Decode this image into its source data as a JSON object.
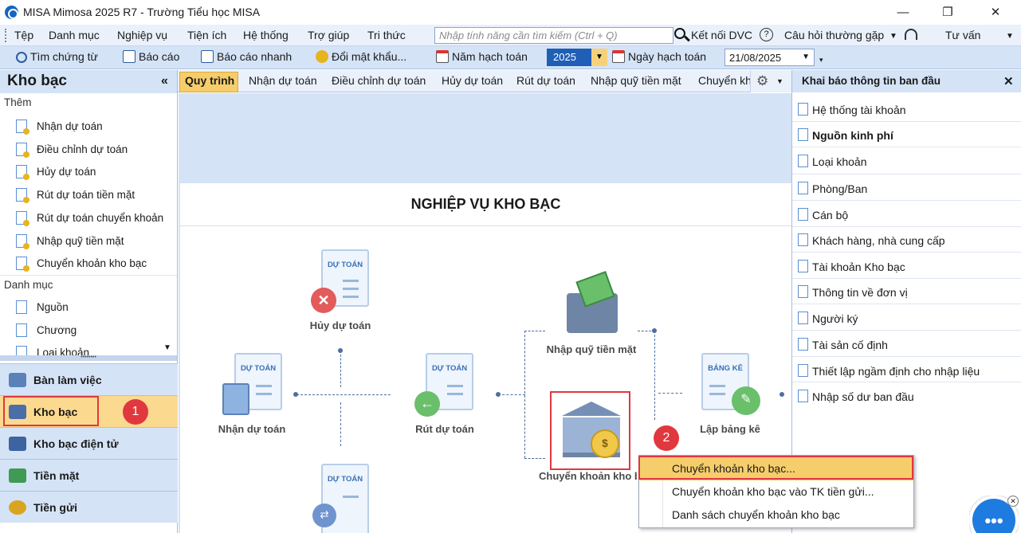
{
  "window": {
    "title": "MISA Mimosa 2025 R7 - Trường Tiểu học MISA",
    "minimize": "—",
    "maximize": "❐",
    "close": "✕"
  },
  "menu": {
    "items": [
      "Tệp",
      "Danh mục",
      "Nghiệp vụ",
      "Tiện ích",
      "Hệ thống",
      "Trợ giúp",
      "Tri thức"
    ],
    "search_placeholder": "Nhập tính năng cần tìm kiếm (Ctrl + Q)",
    "dvc": "Kết nối DVC",
    "faq": "Câu hỏi thường gặp",
    "consult": "Tư vấn"
  },
  "toolbar": {
    "find_doc": "Tìm chứng từ",
    "report": "Báo cáo",
    "quick_report": "Báo cáo nhanh",
    "change_password": "Đổi mật khẩu...",
    "fiscal_year_label": "Năm hạch toán",
    "fiscal_year": "2025",
    "posting_date_label": "Ngày hạch toán",
    "posting_date": "21/08/2025"
  },
  "left_panel": {
    "title": "Kho bạc",
    "collapse": "«",
    "add_section": "Thêm",
    "add_items": [
      "Nhận dự toán",
      "Điều chỉnh dự toán",
      "Hủy dự toán",
      "Rút dự toán tiền mặt",
      "Rút dự toán chuyển khoản",
      "Nhập quỹ tiền mặt",
      "Chuyển khoản kho bạc"
    ],
    "catalog_section": "Danh mục",
    "catalog_items": [
      "Nguồn",
      "Chương",
      "Loại khoản"
    ],
    "nav": [
      "Bàn làm việc",
      "Kho bạc",
      "Kho bạc điện tử",
      "Tiền mặt",
      "Tiền gửi"
    ]
  },
  "tabs": [
    "Quy trình",
    "Nhận dự toán",
    "Điều chỉnh dự toán",
    "Hủy dự toán",
    "Rút dự toán",
    "Nhập quỹ tiền mặt",
    "Chuyển kh"
  ],
  "flow": {
    "title": "NGHIỆP VỤ KHO BẠC",
    "doc_header": "DỰ TOÁN",
    "list_header": "BẢNG KÊ",
    "steps": {
      "cancel": "Hủy dự toán",
      "receive": "Nhận dự toán",
      "withdraw": "Rút dự toán",
      "cash_in": "Nhập quỹ tiền mặt",
      "transfer": "Chuyển khoản kho b",
      "statement": "Lập bảng kê"
    }
  },
  "right_panel": {
    "title": "Khai báo thông tin ban đầu",
    "close": "✕",
    "items": [
      "Hệ thống tài khoản",
      "Nguồn kinh phí",
      "Loại khoản",
      "Phòng/Ban",
      "Cán bộ",
      "Khách hàng, nhà cung cấp",
      "Tài khoản Kho bạc",
      "Thông tin về đơn vị",
      "Người ký",
      "Tài sản cố định",
      "Thiết lập ngầm định cho nhập liệu",
      "Nhập số dư ban đầu"
    ]
  },
  "context_menu": {
    "items": [
      "Chuyển khoản kho bạc...",
      "Chuyển khoản kho bạc vào TK tiền gửi...",
      "Danh sách chuyển khoản kho bạc"
    ]
  },
  "annotations": {
    "badge1": "1",
    "badge2": "2"
  },
  "colors": {
    "accent": "#1f5fb6",
    "highlight": "#f6cd6b",
    "annotation": "#e0383e",
    "panel": "#d4e3f6"
  }
}
